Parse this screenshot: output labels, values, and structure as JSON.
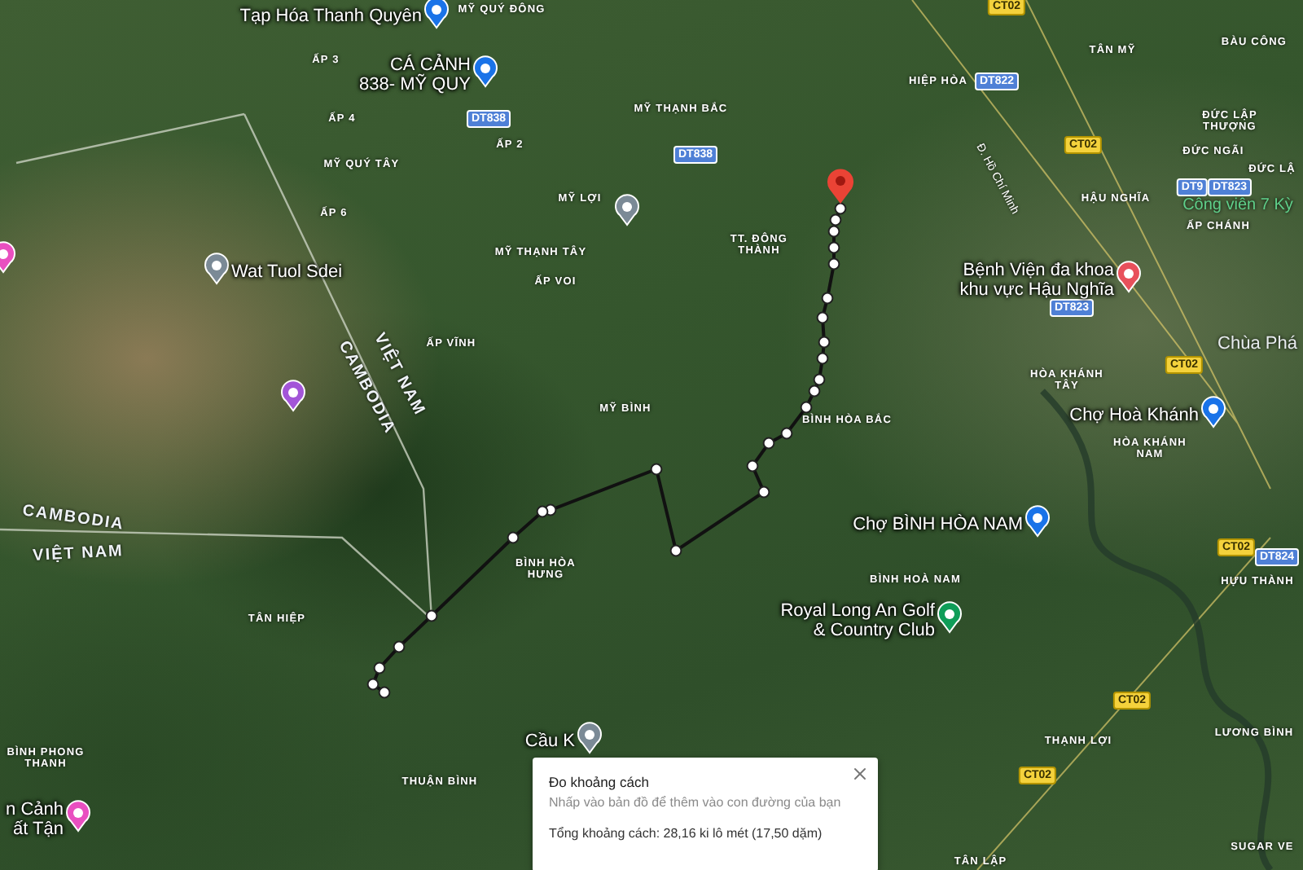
{
  "map": {
    "labels": [
      {
        "kind": "area",
        "text": "MỸ QUÝ ĐÔNG"
      },
      {
        "kind": "area",
        "text": "ẤP 3"
      },
      {
        "kind": "area",
        "text": "ẤP 4"
      },
      {
        "kind": "area",
        "text": "ẤP 2"
      },
      {
        "kind": "area",
        "text": "MỸ QUÝ TÂY"
      },
      {
        "kind": "area",
        "text": "ẤP 6"
      },
      {
        "kind": "area",
        "text": "MỸ THẠNH BẮC"
      },
      {
        "kind": "area",
        "text": "MỸ LỢI"
      },
      {
        "kind": "area",
        "text": "MỸ THẠNH TÂY"
      },
      {
        "kind": "area",
        "text": "TT. ĐÔNG THÀNH"
      },
      {
        "kind": "area",
        "text": "ẤP VOI"
      },
      {
        "kind": "area",
        "text": "ẤP VĨNH"
      },
      {
        "kind": "area",
        "text": "MỸ BÌNH"
      },
      {
        "kind": "area",
        "text": "BÌNH HÒA BẮC"
      },
      {
        "kind": "area",
        "text": "BÌNH HÒA HƯNG"
      },
      {
        "kind": "area",
        "text": "TÂN HIỆP"
      },
      {
        "kind": "area",
        "text": "BÌNH PHONG THANH"
      },
      {
        "kind": "area",
        "text": "THUẬN BÌNH"
      },
      {
        "kind": "area",
        "text": "BÌNH HOÀ NAM"
      },
      {
        "kind": "area",
        "text": "THẠNH LỢI"
      },
      {
        "kind": "area",
        "text": "TÂN LẬP"
      },
      {
        "kind": "area",
        "text": "HÒA KHÁNH NAM"
      },
      {
        "kind": "area",
        "text": "HÒA KHÁNH TÂY"
      },
      {
        "kind": "area",
        "text": "ĐỨC LẬP THƯỢNG"
      },
      {
        "kind": "area",
        "text": "ĐỨC NGÃI"
      },
      {
        "kind": "area",
        "text": "ĐỨC LẬ"
      },
      {
        "kind": "area",
        "text": "HẬU NGHĨA"
      },
      {
        "kind": "area",
        "text": "ẤP CHÁNH"
      },
      {
        "kind": "area",
        "text": "BÀU CÔNG"
      },
      {
        "kind": "area",
        "text": "TÂN MỸ"
      },
      {
        "kind": "area",
        "text": "HIỆP HÒA"
      },
      {
        "kind": "area",
        "text": "HỰU THÀNH"
      },
      {
        "kind": "area",
        "text": "LƯƠNG BÌNH"
      },
      {
        "kind": "area",
        "text": "SUGAR VE"
      },
      {
        "kind": "border",
        "text": "VIỆT NAM"
      },
      {
        "kind": "border",
        "text": "CAMBODIA"
      },
      {
        "kind": "border",
        "text": "CAMBODIA"
      },
      {
        "kind": "border",
        "text": "VIỆT NAM"
      },
      {
        "kind": "road",
        "text": "Đ. Hồ Chí Minh"
      }
    ],
    "place_labels": [
      {
        "kind": "park",
        "text": "Công viên 7 Kỳ"
      },
      {
        "kind": "place",
        "text": "Chùa Phá"
      }
    ],
    "pois": [
      {
        "lines": [
          "Tạp Hóa Thanh Quyên"
        ],
        "color": "#1a73e8"
      },
      {
        "lines": [
          "CÁ CẢNH",
          "838- MỸ QUY"
        ],
        "color": "#1a73e8"
      },
      {
        "lines": [
          "Wat Tuol Sdei"
        ],
        "color": "#7b8a96"
      },
      {
        "lines": [
          "Bệnh Viện đa khoa",
          "khu vực Hậu Nghĩa"
        ],
        "color": "#e8505b"
      },
      {
        "lines": [
          "Chợ Hoà Khánh"
        ],
        "color": "#1a73e8"
      },
      {
        "lines": [
          "Chợ BÌNH HÒA NAM"
        ],
        "color": "#1a73e8"
      },
      {
        "lines": [
          "Royal Long An Golf",
          "& Country Club"
        ],
        "color": "#0f9d58"
      },
      {
        "lines": [
          "Cầu K"
        ],
        "color": "#7b8a96"
      },
      {
        "lines": [
          "n Cảnh",
          "ất Tận"
        ],
        "color": "#e94fc0"
      },
      {
        "color": "#e94fc0"
      },
      {
        "color": "#a355d8"
      },
      {
        "color": "#7b8a96"
      }
    ],
    "road_badges": [
      {
        "kind": "provincial",
        "text": "DT838"
      },
      {
        "kind": "provincial",
        "text": "DT838"
      },
      {
        "kind": "provincial",
        "text": "DT822"
      },
      {
        "kind": "national",
        "text": "CT02"
      },
      {
        "kind": "national",
        "text": "CT02"
      },
      {
        "kind": "provincial",
        "text": "DT9"
      },
      {
        "kind": "provincial",
        "text": "DT823"
      },
      {
        "kind": "provincial",
        "text": "DT823"
      },
      {
        "kind": "national",
        "text": "CT02"
      },
      {
        "kind": "national",
        "text": "CT02"
      },
      {
        "kind": "provincial",
        "text": "DT824"
      },
      {
        "kind": "national",
        "text": "CT02"
      },
      {
        "kind": "national",
        "text": "CT02"
      }
    ]
  },
  "measure_panel": {
    "title": "Đo khoảng cách",
    "hint": "Nhấp vào bản đồ để thêm vào con đường của bạn",
    "total": "Tổng khoảng cách: 28,16 ki lô mét (17,50 dặm)"
  }
}
